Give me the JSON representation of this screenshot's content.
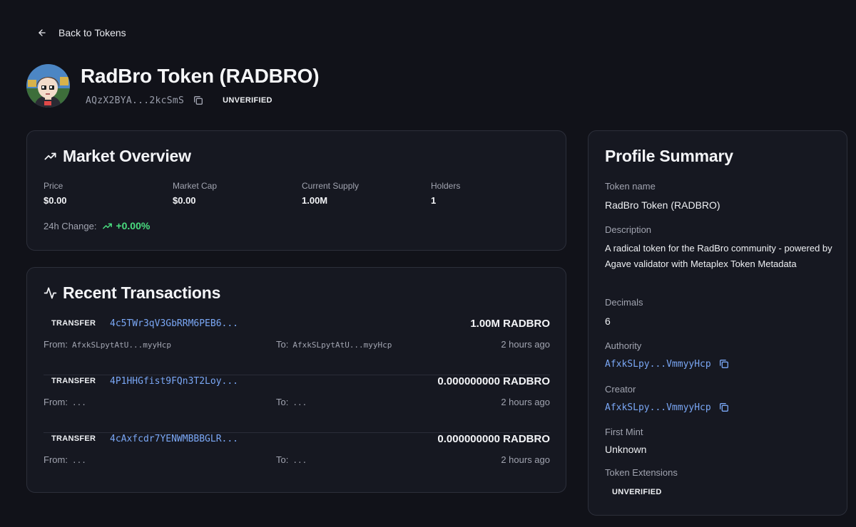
{
  "nav": {
    "back_label": "Back to Tokens"
  },
  "token": {
    "title": "RadBro Token (RADBRO)",
    "address_short": "AQzX2BYA...2kcSmS",
    "status_badge": "UNVERIFIED"
  },
  "market": {
    "title": "Market Overview",
    "stats": [
      {
        "label": "Price",
        "value": "$0.00"
      },
      {
        "label": "Market Cap",
        "value": "$0.00"
      },
      {
        "label": "Current Supply",
        "value": "1.00M"
      },
      {
        "label": "Holders",
        "value": "1"
      }
    ],
    "change_label": "24h Change:",
    "change_value": "+0.00%"
  },
  "transactions": {
    "title": "Recent Transactions",
    "from_label": "From:",
    "to_label": "To:",
    "rows": [
      {
        "type": "TRANSFER",
        "signature": "4c5TWr3qV3GbRRM6PEB6...",
        "amount": "1.00M RADBRO",
        "from": "AfxkSLpytAtU...myyHcp",
        "to": "AfxkSLpytAtU...myyHcp",
        "time": "2 hours ago"
      },
      {
        "type": "TRANSFER",
        "signature": "4P1HHGfist9FQn3T2Loy...",
        "amount": "0.000000000 RADBRO",
        "from": "...",
        "to": "...",
        "time": "2 hours ago"
      },
      {
        "type": "TRANSFER",
        "signature": "4cAxfcdr7YENWMBBBGLR...",
        "amount": "0.000000000 RADBRO",
        "from": "...",
        "to": "...",
        "time": "2 hours ago"
      }
    ]
  },
  "profile": {
    "title": "Profile Summary",
    "token_name_label": "Token name",
    "token_name": "RadBro Token (RADBRO)",
    "description_label": "Description",
    "description": "A radical token for the RadBro community - powered by Agave validator with Metaplex Token Metadata",
    "decimals_label": "Decimals",
    "decimals": "6",
    "authority_label": "Authority",
    "authority": "AfxkSLpy...VmmyyHcp",
    "creator_label": "Creator",
    "creator": "AfxkSLpy...VmmyyHcp",
    "first_mint_label": "First Mint",
    "first_mint": "Unknown",
    "extensions_label": "Token Extensions",
    "extensions_badge": "UNVERIFIED"
  },
  "icons": {
    "back": "arrow-left-icon",
    "copy": "copy-icon",
    "trend": "trending-up-icon",
    "activity": "activity-icon"
  },
  "colors": {
    "background": "#111219",
    "card": "#161821",
    "link": "#7aa7f5",
    "positive": "#4ade80"
  }
}
